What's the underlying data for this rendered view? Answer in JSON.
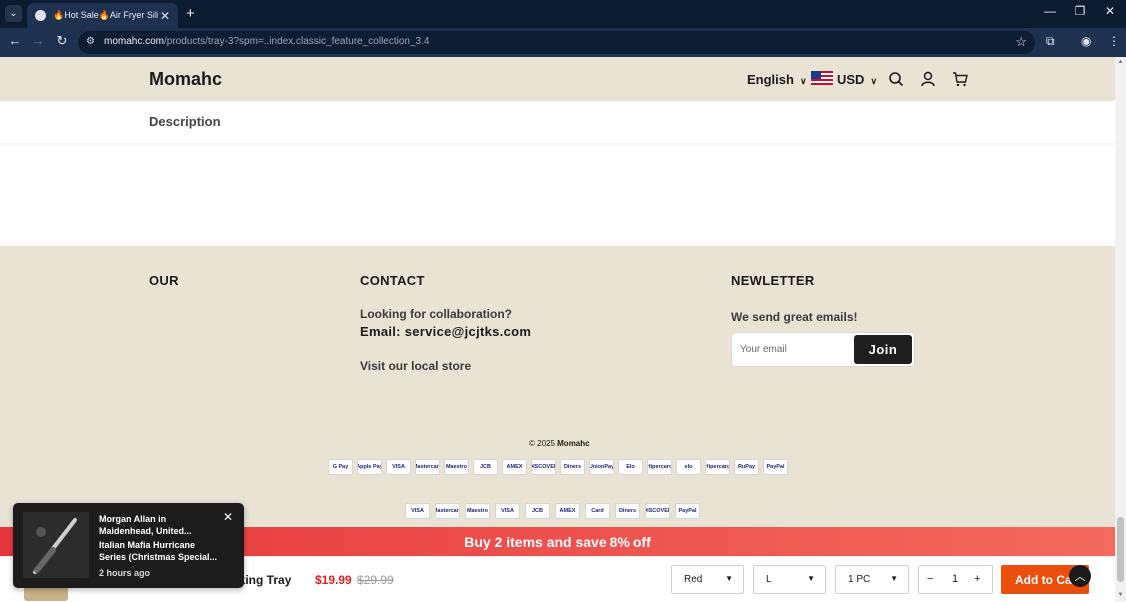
{
  "browser": {
    "tab_title": "🔥Hot Sale🔥Air Fryer Silicone",
    "new_tab": "+",
    "tab_close": "✕",
    "tab_menu": "⌄",
    "url_domain": "momahc.com",
    "url_path": "/products/tray-3?spm=..index.classic_feature_collection_3.4"
  },
  "header": {
    "logo": "Momahc",
    "language": "English",
    "currency": "USD"
  },
  "description_tab": "Description",
  "footer": {
    "col1_heading": "OUR",
    "contact_heading": "CONTACT",
    "collab_text": "Looking for collaboration?",
    "email_text": "Email:  service@jcjtks.com",
    "store_link": "Visit our local store",
    "newsletter_heading": "NEWLETTER",
    "newsletter_text": "We send great emails!",
    "email_placeholder": "Your email",
    "join_label": "Join",
    "copyright_prefix": "© 2025 ",
    "copyright_brand": "Momahc",
    "payment_row1": [
      "G Pay",
      "Apple Pay",
      "VISA",
      "Mastercard",
      "Maestro",
      "JCB",
      "AMEX",
      "DISCOVER",
      "Diners",
      "UnionPay",
      "Elo",
      "Hipercard",
      "elo",
      "Hipercard",
      "RuPay",
      "PayPal"
    ],
    "payment_row2": [
      "VISA",
      "Mastercard",
      "Maestro",
      "VISA",
      "JCB",
      "AMEX",
      "Card",
      "Diners",
      "DISCOVER",
      "PayPal"
    ]
  },
  "promo": {
    "prefix": "Buy 2 items and save ",
    "highlight": "8%",
    "suffix": " off"
  },
  "sticky": {
    "title": "aking Tray",
    "price": "$19.99",
    "compare_price": "$29.99",
    "color": "Red",
    "size": "L",
    "pack": "1 PC",
    "qty_minus": "−",
    "quantity": "1",
    "qty_plus": "+",
    "add_to_cart": "Add to Cart"
  },
  "popup": {
    "name": "Morgan Allan in Maidenhead, United...",
    "product": "Italian Mafia Hurricane Series (Christmas Special...",
    "time": "2 hours ago"
  }
}
